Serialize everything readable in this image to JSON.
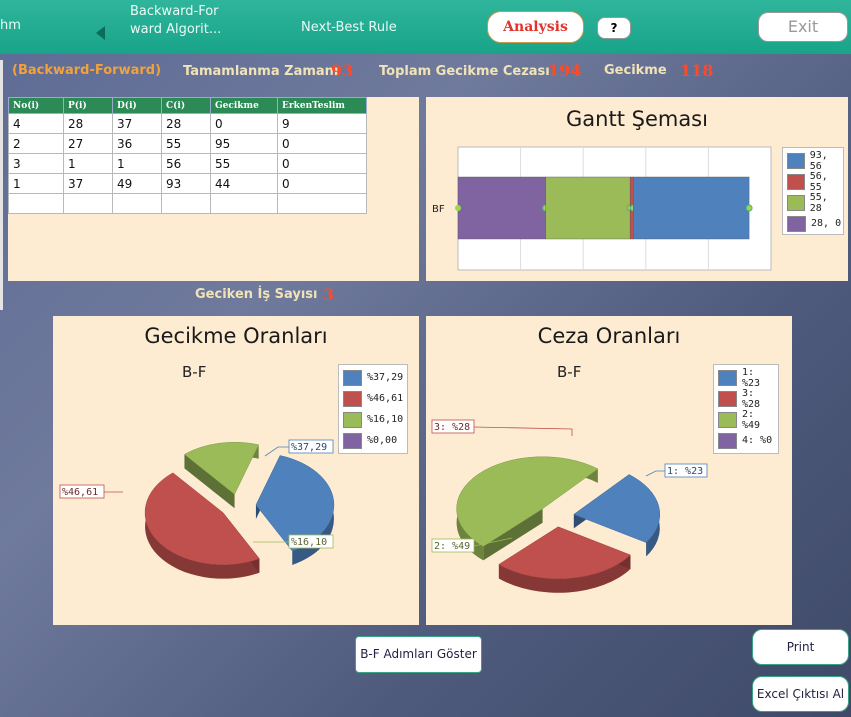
{
  "topbar": {
    "nav_partial": "hm",
    "nav_backward": "Backward-For\nward Algorit...",
    "nav_nextbest": "Next-Best Rule",
    "analysis_label": "Analysis",
    "help_label": "?",
    "exit_label": "Exit"
  },
  "summary": {
    "method": "(Backward-Forward)",
    "completion_label": "Tamamlanma Zamanı",
    "completion_value": "93",
    "penalty_label": "Toplam Gecikme Cezası",
    "penalty_value": "194",
    "delay_label": "Gecikme",
    "delay_value": "118",
    "late_count_label": "Geciken İş Sayısı",
    "late_count_value": "3"
  },
  "table": {
    "headers": [
      "No(i)",
      "P(i)",
      "D(i)",
      "C(i)",
      "Gecikme",
      "ErkenTeslim"
    ],
    "rows": [
      [
        "4",
        "28",
        "37",
        "28",
        "0",
        "9"
      ],
      [
        "2",
        "27",
        "36",
        "55",
        "95",
        "0"
      ],
      [
        "3",
        "1",
        "1",
        "56",
        "55",
        "0"
      ],
      [
        "1",
        "37",
        "49",
        "93",
        "44",
        "0"
      ],
      [
        "",
        "",
        "",
        "",
        "",
        ""
      ]
    ]
  },
  "gantt": {
    "title": "Gantt Şeması",
    "row_label": "BF",
    "legend": [
      "93, 56",
      "56, 55",
      "55, 28",
      "28, 0"
    ],
    "colors": [
      "#4f81bd",
      "#c0504d",
      "#9bbb59",
      "#8064a2"
    ]
  },
  "chart_data": [
    {
      "type": "bar",
      "title": "Gantt Şeması",
      "categories": [
        "BF"
      ],
      "series": [
        {
          "name": "28, 0",
          "start": 0,
          "end": 28,
          "color": "#8064a2"
        },
        {
          "name": "55, 28",
          "start": 28,
          "end": 55,
          "color": "#9bbb59"
        },
        {
          "name": "56, 55",
          "start": 55,
          "end": 56,
          "color": "#c0504d"
        },
        {
          "name": "93, 56",
          "start": 56,
          "end": 93,
          "color": "#4f81bd"
        }
      ],
      "xlim": [
        0,
        100
      ],
      "grid": true,
      "legend": "right"
    },
    {
      "type": "pie",
      "title": "Gecikme Oranları",
      "subtitle": "B-F",
      "labels": [
        "%37,29",
        "%46,61",
        "%16,10",
        "%0,00"
      ],
      "values": [
        37.29,
        46.61,
        16.1,
        0.0
      ],
      "colors": [
        "#4f81bd",
        "#c0504d",
        "#9bbb59",
        "#8064a2"
      ],
      "legend": "top-right"
    },
    {
      "type": "pie",
      "title": "Ceza Oranları",
      "subtitle": "B-F",
      "labels": [
        "1: %23",
        "3: %28",
        "2: %49",
        "4: %0"
      ],
      "values": [
        23,
        28,
        49,
        0
      ],
      "colors": [
        "#4f81bd",
        "#c0504d",
        "#9bbb59",
        "#8064a2"
      ],
      "legend": "top-right"
    }
  ],
  "buttons": {
    "steps": "B-F Adımları Göster",
    "print": "Print",
    "excel": "Excel Çıktısı Al"
  }
}
